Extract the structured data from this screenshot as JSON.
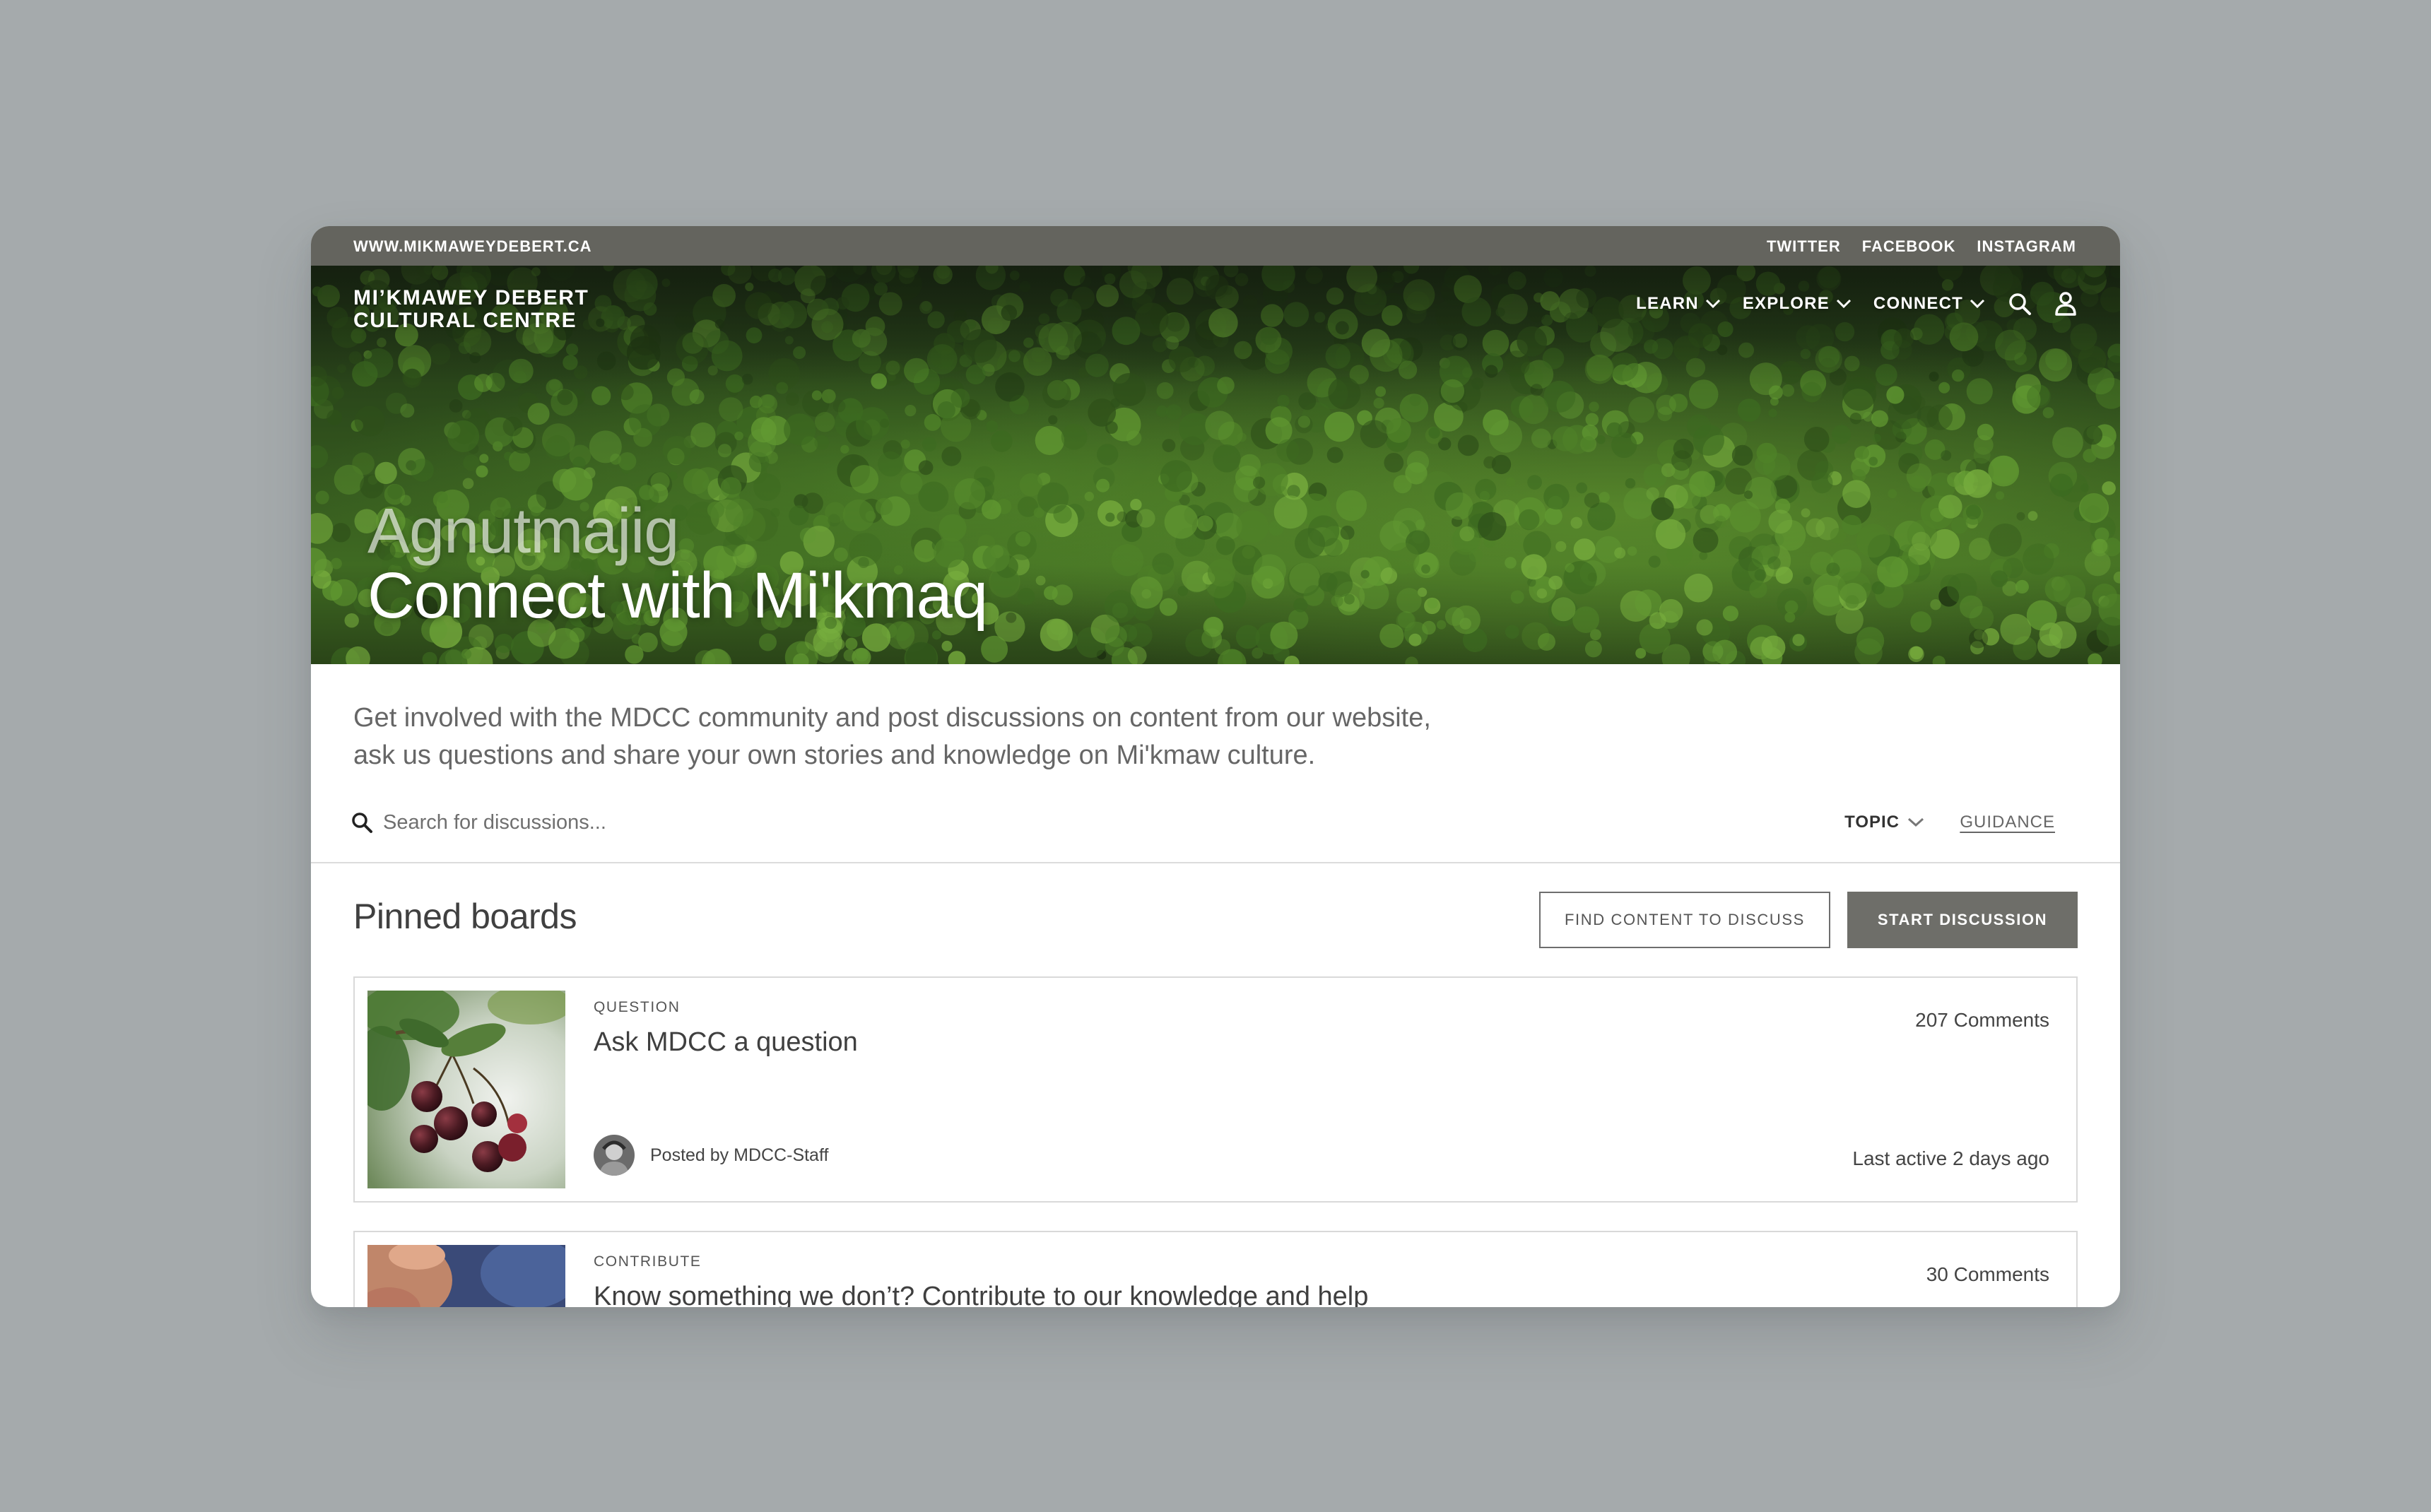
{
  "topbar": {
    "site_url": "WWW.MIKMAWEYDEBERT.CA",
    "social": [
      "TWITTER",
      "FACEBOOK",
      "INSTAGRAM"
    ]
  },
  "header": {
    "brand_line1": "MI’KMAWEY DEBERT",
    "brand_line2": "CULTURAL CENTRE",
    "nav": [
      "LEARN",
      "EXPLORE",
      "CONNECT"
    ],
    "icons": [
      "search-icon",
      "user-icon",
      "chevron-down-icon"
    ]
  },
  "hero": {
    "subtitle": "Agnutmajig",
    "title": "Connect with Mi'kmaq"
  },
  "intro": {
    "line1": "Get involved with the MDCC community and post discussions on content from our website,",
    "line2": "ask us questions and share your own stories and knowledge on Mi'kmaw culture."
  },
  "search": {
    "placeholder": "Search for discussions...",
    "topic_label": "TOPIC",
    "guidance_label": "GUIDANCE"
  },
  "pinned": {
    "title": "Pinned boards",
    "find_button": "FIND CONTENT TO DISCUSS",
    "start_button": "START DISCUSSION",
    "cards": [
      {
        "category": "QUESTION",
        "title": "Ask MDCC a question",
        "comments": "207 Comments",
        "author": "Posted by MDCC-Staff",
        "last_active": "Last active 2 days ago"
      },
      {
        "category": "CONTRIBUTE",
        "title": "Know something we don’t? Contribute to our knowledge and help",
        "comments": "30 Comments"
      }
    ]
  },
  "colors": {
    "topbar": "#64645e",
    "page_background": "#a5aaac",
    "primary_button": "#6e6e69",
    "forest_green": "#3f6a22"
  }
}
